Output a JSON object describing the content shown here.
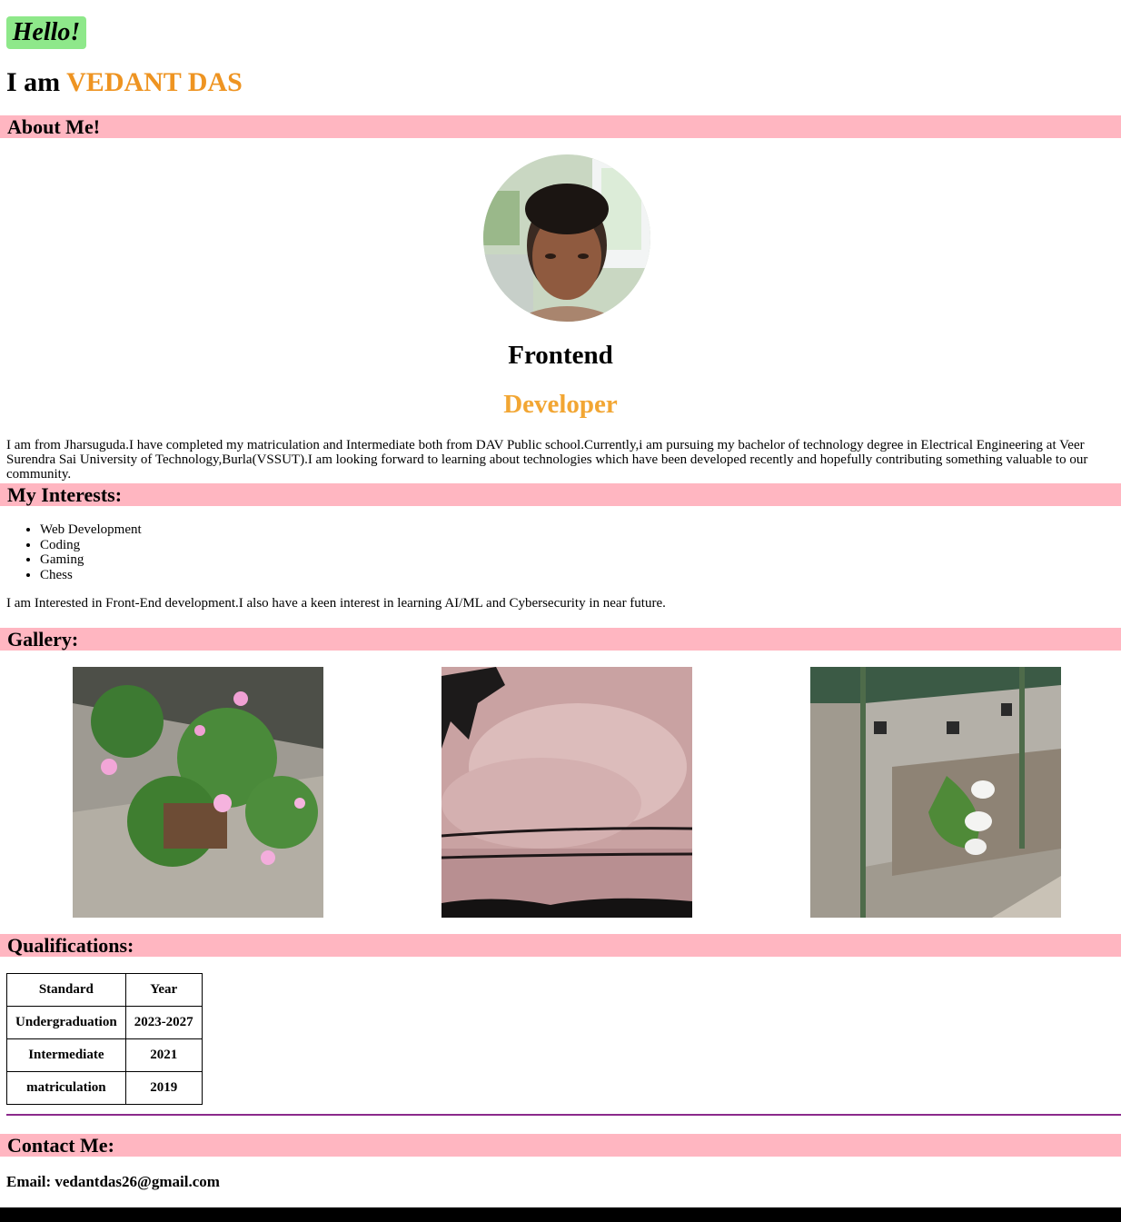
{
  "header": {
    "greeting": "Hello!",
    "intro_prefix": "I am",
    "name": "VEDANT DAS"
  },
  "about": {
    "heading": "About Me!",
    "role_line1": "Frontend",
    "role_line2": "Developer",
    "bio": "I am from Jharsuguda.I have completed my matriculation and Intermediate both from DAV Public school.Currently,i am pursuing my bachelor of technology degree in Electrical Engineering at Veer Surendra Sai University of Technology,Burla(VSSUT).I am looking forward to learning about technologies which have been developed recently and hopefully contributing something valuable to our community."
  },
  "interests": {
    "heading": "My Interests:",
    "items": [
      "Web Development",
      "Coding",
      "Gaming",
      "Chess"
    ],
    "note": "I am Interested in Front-End development.I also have a keen interest in learning AI/ML and Cybersecurity in near future."
  },
  "gallery": {
    "heading": "Gallery:"
  },
  "qualifications": {
    "heading": "Qualifications:",
    "columns": [
      "Standard",
      "Year"
    ],
    "rows": [
      [
        "Undergraduation",
        "2023-2027"
      ],
      [
        "Intermediate",
        "2021"
      ],
      [
        "matriculation",
        "2019"
      ]
    ]
  },
  "contact": {
    "heading": "Contact Me:",
    "email": "Email: vedantdas26@gmail.com"
  },
  "colors": {
    "section_bar": "#ffb6c1",
    "name_accent": "#ee9422",
    "developer_accent": "#f2a633",
    "hello_bg": "#8ee88a",
    "divider": "#8b2a8b"
  }
}
